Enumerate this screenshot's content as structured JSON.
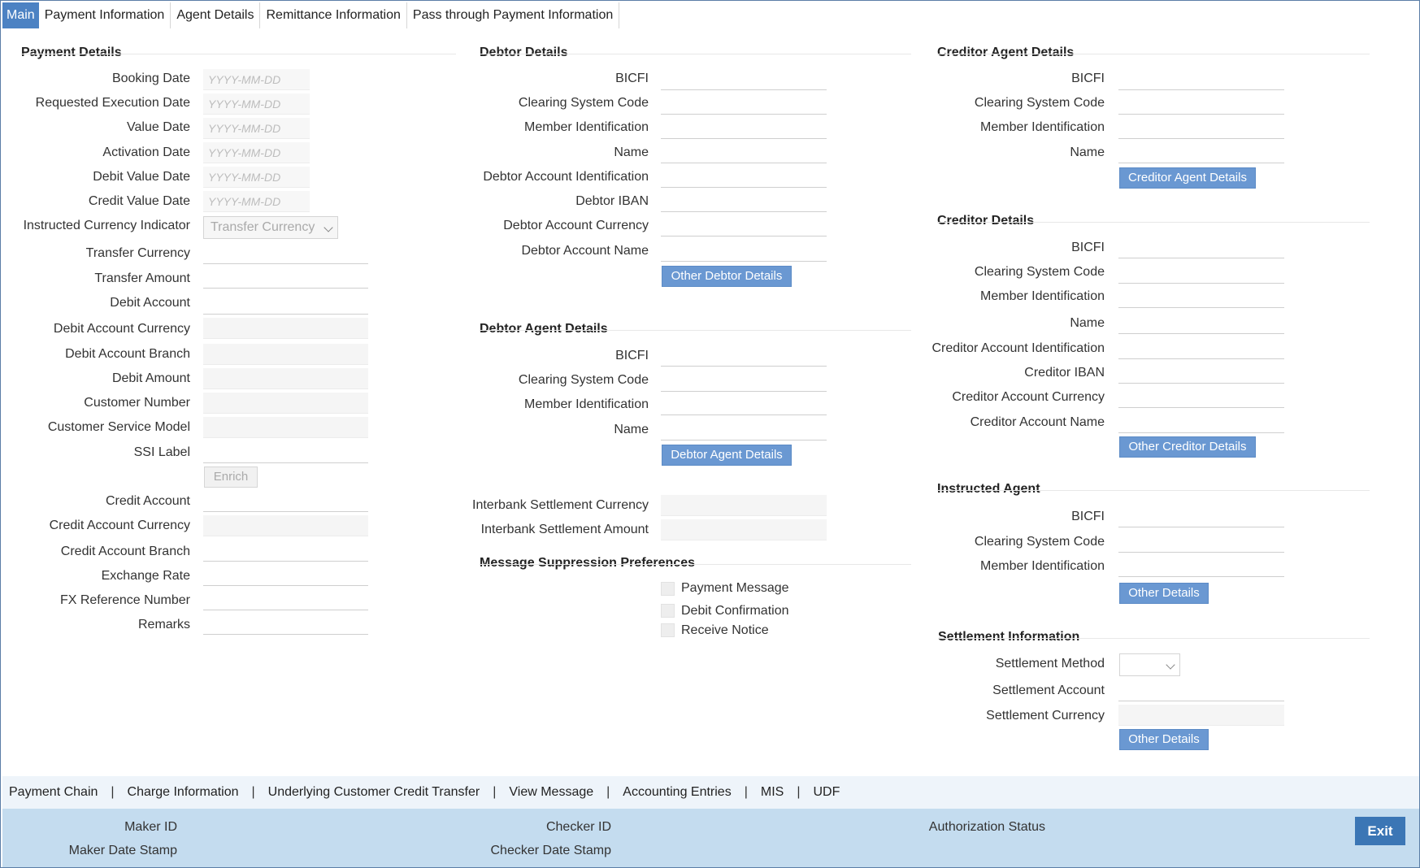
{
  "tabs": [
    "Main",
    "Payment Information",
    "Agent Details",
    "Remittance Information",
    "Pass through Payment Information"
  ],
  "payment_details": {
    "title": "Payment Details",
    "booking_date": "Booking Date",
    "requested_execution_date": "Requested Execution Date",
    "value_date": "Value Date",
    "activation_date": "Activation Date",
    "debit_value_date": "Debit Value Date",
    "credit_value_date": "Credit Value Date",
    "date_placeholder": "YYYY-MM-DD",
    "instructed_currency_indicator": "Instructed Currency Indicator",
    "instructed_currency_value": "Transfer Currency",
    "transfer_currency": "Transfer Currency",
    "transfer_amount": "Transfer Amount",
    "debit_account": "Debit Account",
    "debit_account_currency": "Debit Account Currency",
    "debit_account_branch": "Debit Account Branch",
    "debit_amount": "Debit Amount",
    "customer_number": "Customer Number",
    "customer_service_model": "Customer Service Model",
    "ssi_label": "SSI Label",
    "enrich_button": "Enrich",
    "credit_account": "Credit Account",
    "credit_account_currency": "Credit Account Currency",
    "credit_account_branch": "Credit Account Branch",
    "exchange_rate": "Exchange Rate",
    "fx_reference_number": "FX Reference Number",
    "remarks": "Remarks"
  },
  "debtor_details": {
    "title": "Debtor Details",
    "bicfi": "BICFI",
    "clearing_system_code": "Clearing System Code",
    "member_identification": "Member Identification",
    "name": "Name",
    "debtor_account_identification": "Debtor Account Identification",
    "debtor_iban": "Debtor IBAN",
    "debtor_account_currency": "Debtor Account Currency",
    "debtor_account_name": "Debtor Account Name",
    "other_button": "Other Debtor Details"
  },
  "debtor_agent": {
    "title": "Debtor Agent Details",
    "bicfi": "BICFI",
    "clearing_system_code": "Clearing System Code",
    "member_identification": "Member Identification",
    "name": "Name",
    "button": "Debtor Agent Details"
  },
  "interbank": {
    "settlement_currency": "Interbank Settlement Currency",
    "settlement_amount": "Interbank Settlement Amount"
  },
  "suppression": {
    "title": "Message Suppression Preferences",
    "payment_message": "Payment Message",
    "debit_confirmation": "Debit Confirmation",
    "receive_notice": "Receive Notice"
  },
  "creditor_agent": {
    "title": "Creditor Agent Details",
    "bicfi": "BICFI",
    "clearing_system_code": "Clearing System Code",
    "member_identification": "Member Identification",
    "name": "Name",
    "button": "Creditor Agent Details"
  },
  "creditor_details": {
    "title": "Creditor Details",
    "bicfi": "BICFI",
    "clearing_system_code": "Clearing System Code",
    "member_identification": "Member Identification",
    "name": "Name",
    "creditor_account_identification": "Creditor Account Identification",
    "creditor_iban": "Creditor IBAN",
    "creditor_account_currency": "Creditor Account Currency",
    "creditor_account_name": "Creditor Account Name",
    "other_button": "Other Creditor Details"
  },
  "instructed_agent": {
    "title": "Instructed Agent",
    "bicfi": "BICFI",
    "clearing_system_code": "Clearing System Code",
    "member_identification": "Member Identification",
    "other_button": "Other Details"
  },
  "settlement": {
    "title": "Settlement Information",
    "method": "Settlement Method",
    "account": "Settlement Account",
    "currency": "Settlement Currency",
    "other_button": "Other Details"
  },
  "bottom_links": [
    "Payment Chain",
    "Charge Information",
    "Underlying Customer Credit Transfer",
    "View Message",
    "Accounting Entries",
    "MIS",
    "UDF"
  ],
  "bottom_separator": "|",
  "footer": {
    "maker_id": "Maker ID",
    "maker_date_stamp": "Maker Date Stamp",
    "checker_id": "Checker ID",
    "checker_date_stamp": "Checker Date Stamp",
    "authorization_status": "Authorization Status",
    "exit_button": "Exit"
  },
  "colors": {
    "active_tab": "#4c82c3",
    "button": "#6a98d2",
    "footer_bg": "#c4dcef",
    "exit_button": "#3b76b5"
  }
}
